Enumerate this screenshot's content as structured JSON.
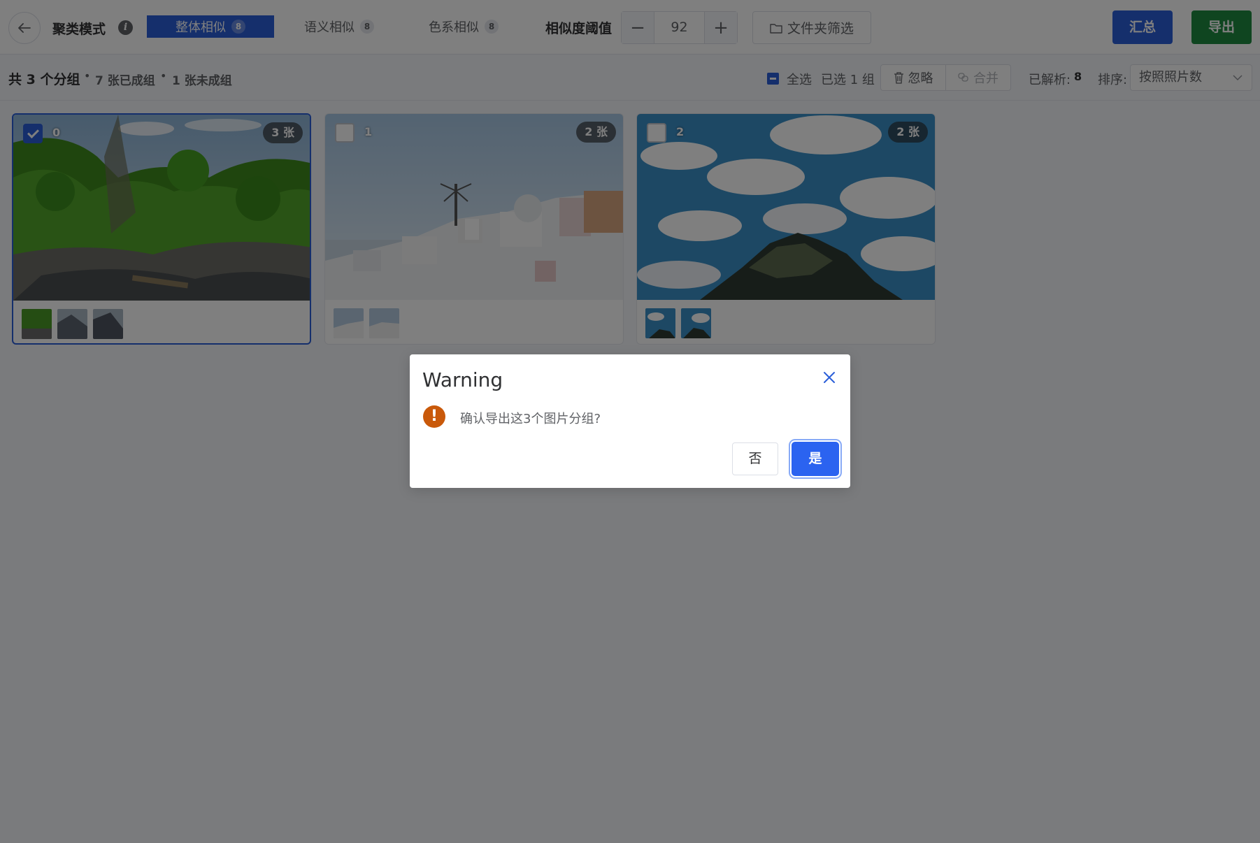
{
  "toolbar": {
    "mode_title": "聚类模式",
    "info_icon": "info-icon",
    "tabs": [
      {
        "label": "整体相似",
        "count": "8",
        "active": true
      },
      {
        "label": "语义相似",
        "count": "8",
        "active": false
      },
      {
        "label": "色系相似",
        "count": "8",
        "active": false
      }
    ],
    "threshold_label": "相似度阈值",
    "threshold_value": "92",
    "stepper_minus": "−",
    "stepper_plus": "+",
    "folder_filter_label": "文件夹筛选",
    "summary_label": "汇总",
    "export_label": "导出"
  },
  "stats": {
    "total": "共 3 个分组",
    "dot": "•",
    "grouped": "7 张已成组",
    "ungrouped": "1 张未成组",
    "select_all": "全选",
    "selected": "已选 1 组",
    "ignore": "忽略",
    "merge": "合并",
    "parsed_label": "已解析:",
    "parsed_value": "8",
    "sort_label": "排序:",
    "sort_value": "按照照片数"
  },
  "groups": [
    {
      "id": "0",
      "count_label": "3 张",
      "selected": true,
      "thumb_count": 3,
      "scene": "forest-river"
    },
    {
      "id": "1",
      "count_label": "2 张",
      "selected": false,
      "thumb_count": 2,
      "scene": "white-village"
    },
    {
      "id": "2",
      "count_label": "2 张",
      "selected": false,
      "thumb_count": 2,
      "scene": "sky-cliff"
    }
  ],
  "dialog": {
    "title": "Warning",
    "message": "确认导出这3个图片分组?",
    "warn_icon": "!",
    "no_label": "否",
    "yes_label": "是"
  },
  "colors": {
    "primary": "#2b5fd9",
    "success": "#1e8a41",
    "warning": "#c9590a",
    "overlay": "rgba(0,0,0,0.5)"
  }
}
